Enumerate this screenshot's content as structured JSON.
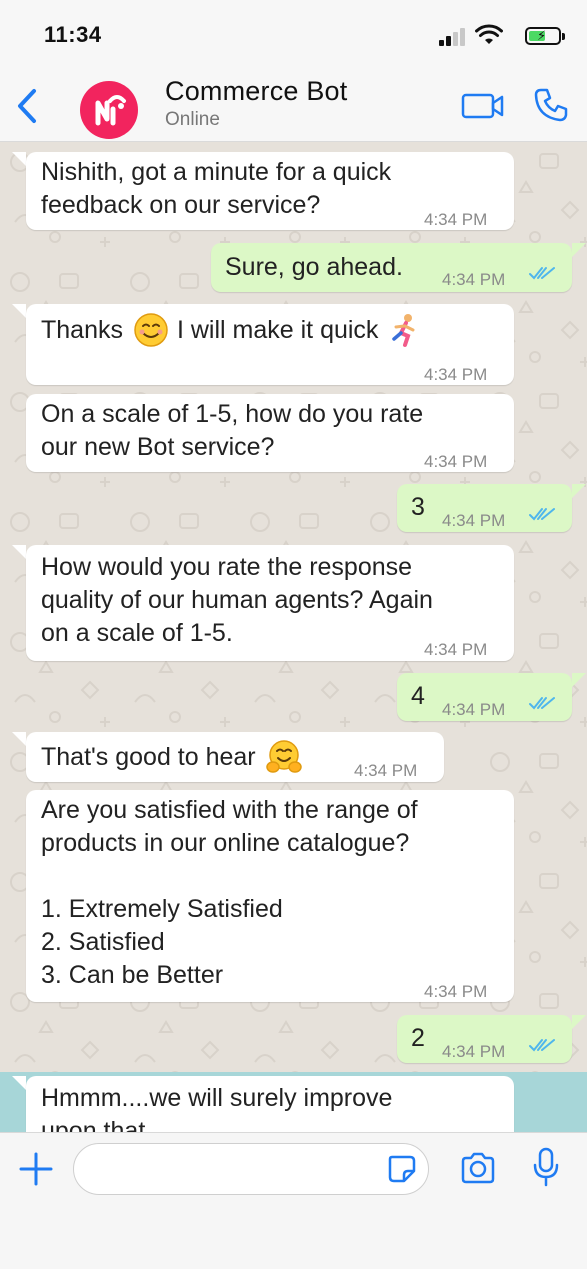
{
  "status_bar": {
    "time": "11:34"
  },
  "header": {
    "title": "Commerce Bot",
    "status": "Online",
    "avatar_color": "#f2245e",
    "accent_color": "#1f7bf2"
  },
  "messages": [
    {
      "dir": "in",
      "text": "Nishith, got a minute for a quick\nfeedback on our service?",
      "time": "4:34 PM"
    },
    {
      "dir": "out",
      "text": "Sure, go ahead.",
      "time": "4:34 PM"
    },
    {
      "dir": "in",
      "text_before": "Thanks",
      "text_after": "I will make it quick",
      "time": "4:34 PM"
    },
    {
      "dir": "in",
      "text": "On a scale of 1-5, how do you rate\nour new Bot service?",
      "time": "4:34 PM"
    },
    {
      "dir": "out",
      "text": "3",
      "time": "4:34 PM"
    },
    {
      "dir": "in",
      "text": "How would you rate the response\nquality of our human agents? Again\non a scale of 1-5.",
      "time": "4:34 PM"
    },
    {
      "dir": "out",
      "text": "4",
      "time": "4:34 PM"
    },
    {
      "dir": "in",
      "text": "That's good to hear",
      "time": "4:34 PM"
    },
    {
      "dir": "in",
      "text": "Are you satisfied with the range of\nproducts in our online catalogue?\n\n1. Extremely Satisfied\n2. Satisfied\n3. Can be Better",
      "time": "4:34 PM"
    },
    {
      "dir": "out",
      "text": "2",
      "time": "4:34 PM"
    },
    {
      "dir": "in",
      "text": "Hmmm....we will surely improve\nupon that",
      "time": ""
    }
  ],
  "input": {
    "placeholder": "",
    "value": ""
  },
  "colors": {
    "incoming_bubble": "#ffffff",
    "outgoing_bubble": "#dcf8c6",
    "wallpaper": "#e6e1da",
    "read_ticks": "#4fb6ec"
  }
}
